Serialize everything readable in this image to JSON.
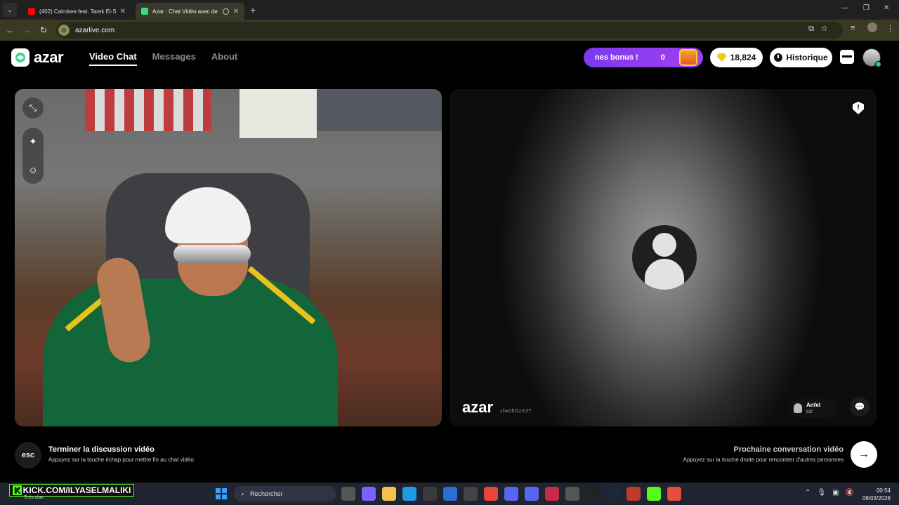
{
  "browser": {
    "tabs": [
      {
        "title": "(402) Cairokee feat. Tarek El-Sh",
        "favicon_color": "#ff0000",
        "active": false
      },
      {
        "title": "Azar : Chat Vidéo avec de r",
        "favicon_color": "#3ddc84",
        "active": true
      }
    ],
    "new_tab_icon": "plus-icon",
    "url": "azarlive.com"
  },
  "header": {
    "logo_text": "azar",
    "nav": [
      {
        "label": "Video Chat",
        "active": true
      },
      {
        "label": "Messages",
        "active": false
      },
      {
        "label": "About",
        "active": false
      }
    ],
    "bonus_text": "nes bonus !",
    "bonus_value": "0",
    "gems": "18,824",
    "history_label": "Historique"
  },
  "video_right": {
    "watermark": "azar",
    "session_id": "zfw0hGzX3T",
    "partner_name": "Anfel",
    "partner_country": "DZ"
  },
  "hints": {
    "esc_key": "esc",
    "end_title": "Terminer la discussion vidéo",
    "end_sub": "Appuyez sur la touche échap pour mettre fin au chat vidéo.",
    "next_title": "Prochaine conversation vidéo",
    "next_sub": "Appuyez sur la touche droite pour rencontrer d'autres personnes"
  },
  "taskbar": {
    "overlay_text": "KICK.COM/ILYASELMALIKI",
    "overlay_badge": "K",
    "weather": "Très clair",
    "search_placeholder": "Rechercher",
    "time": "00:54",
    "date": "08/03/2026"
  },
  "colors": {
    "accent_purple": "#8b3ff0",
    "gem_yellow": "#f5c518",
    "kick_green": "#53fc18"
  }
}
